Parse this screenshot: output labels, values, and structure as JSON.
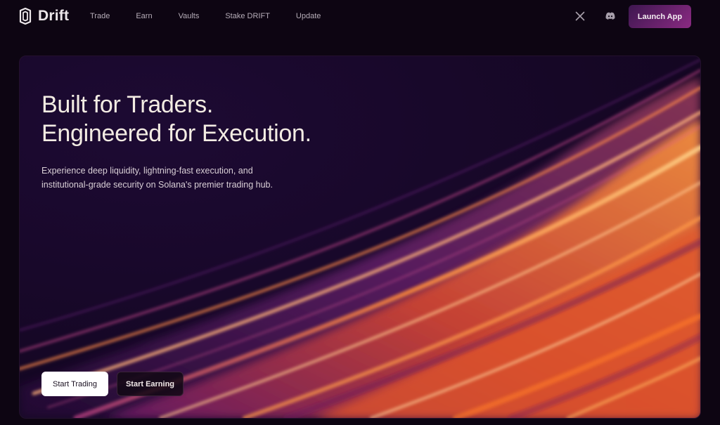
{
  "brand": {
    "name": "Drift",
    "logo_icon": "drift-logo-icon"
  },
  "nav": {
    "links": [
      "Trade",
      "Earn",
      "Vaults",
      "Stake DRIFT",
      "Update"
    ],
    "social": [
      {
        "name": "x-icon",
        "label": "X"
      },
      {
        "name": "discord-icon",
        "label": "Discord"
      }
    ],
    "launch_label": "Launch App"
  },
  "hero": {
    "title_line1": "Built for Traders.",
    "title_line2": "Engineered for Execution.",
    "subtitle": "Experience deep liquidity, lightning-fast execution, and institutional-grade security on Solana's premier trading hub.",
    "primary_cta": "Start Trading",
    "secondary_cta": "Start Earning"
  },
  "colors": {
    "background": "#0d0512",
    "accent_purple": "#8a2a82",
    "accent_orange": "#f06a22",
    "text": "#f3ece3"
  }
}
